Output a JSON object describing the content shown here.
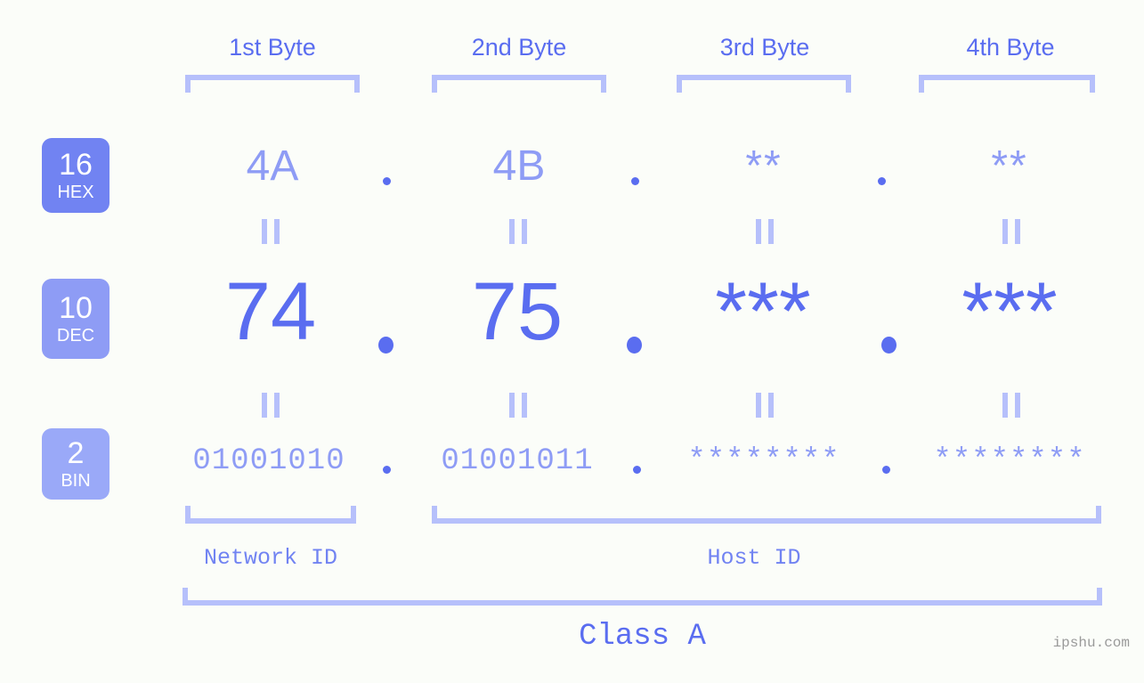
{
  "meta": {
    "watermark": "ipshu.com"
  },
  "columns": [
    {
      "label": "1st Byte"
    },
    {
      "label": "2nd Byte"
    },
    {
      "label": "3rd Byte"
    },
    {
      "label": "4th Byte"
    }
  ],
  "rows": [
    {
      "badge_num": "16",
      "badge_name": "HEX",
      "values": [
        "4A",
        "4B",
        "**",
        "**"
      ],
      "separator": "."
    },
    {
      "badge_num": "10",
      "badge_name": "DEC",
      "values": [
        "74",
        "75",
        "***",
        "***"
      ],
      "separator": "."
    },
    {
      "badge_num": "2",
      "badge_name": "BIN",
      "values": [
        "01001010",
        "01001011",
        "********",
        "********"
      ],
      "separator": "."
    }
  ],
  "equals_mark": "||",
  "sections": {
    "network_id": "Network ID",
    "host_id": "Host ID",
    "class": "Class A"
  },
  "colors": {
    "background": "#fbfdf9",
    "accent_strong": "#5a6df0",
    "accent_mid": "#7183f2",
    "accent_light": "#8e9cf5",
    "accent_pale": "#b6c0fb",
    "badge_hex": "#7183f2",
    "badge_dec": "#8e9cf5",
    "badge_bin": "#9aa9f8",
    "watermark": "#9a9a9a"
  }
}
